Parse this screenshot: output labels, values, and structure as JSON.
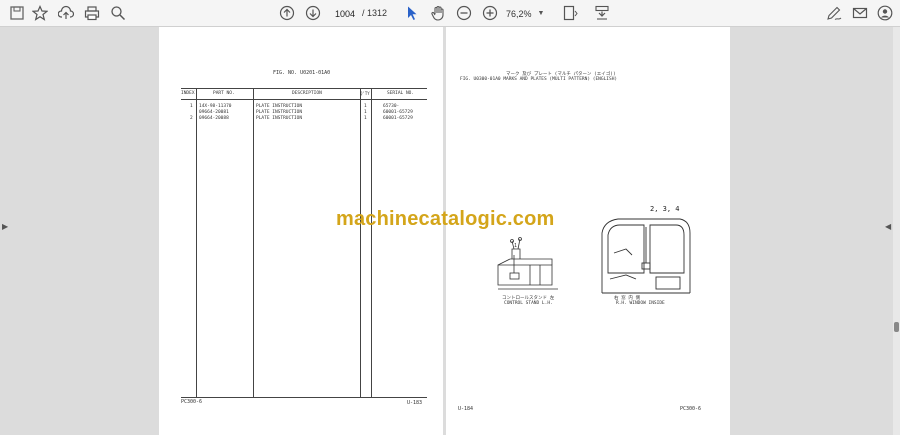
{
  "toolbar": {
    "page_current": "1004",
    "page_total": "/ 1312",
    "zoom": "76,2%"
  },
  "left_page": {
    "fig_no": "FIG. NO.     U0201-01A0",
    "headers": {
      "index": "INDEX",
      "part_no": "PART  NO.",
      "description": "DESCRIPTION",
      "qty": "Q'TY",
      "serial_no": "SERIAL  NO."
    },
    "rows": [
      {
        "index": "1",
        "part_no": "14X-98-11370",
        "description": "PLATE  INSTRUCTION",
        "qty": "1",
        "serial": "65730-"
      },
      {
        "index": "",
        "part_no": "09664-20081",
        "description": "PLATE  INSTRUCTION",
        "qty": "1",
        "serial": "60001-65729"
      },
      {
        "index": "2",
        "part_no": "09664-20088",
        "description": "PLATE  INSTRUCTION",
        "qty": "1",
        "serial": "60001-65729"
      }
    ],
    "footer_left": "PC300-6",
    "footer_right": "U-183"
  },
  "right_page": {
    "title_jp": "マーク  及び  プレート  (マルチ  パターン  (エイゴ))",
    "title_en": "FIG. U0300-01A0    MARKS  AND  PLATES  (MULTI  PATTERN)  (ENGLISH)",
    "callout_1": "1",
    "callout_234": "2, 3, 4",
    "caption_left_jp": "コントロールスタンド  左",
    "caption_left_en": "CONTROL  STAND  L.H.",
    "caption_right_jp": "右    窓    内    側",
    "caption_right_en": "R.H.  WINDOW  INSIDE",
    "footer_left": "U-184",
    "footer_right": "PC300-6"
  },
  "watermark": "machinecatalogic.com"
}
